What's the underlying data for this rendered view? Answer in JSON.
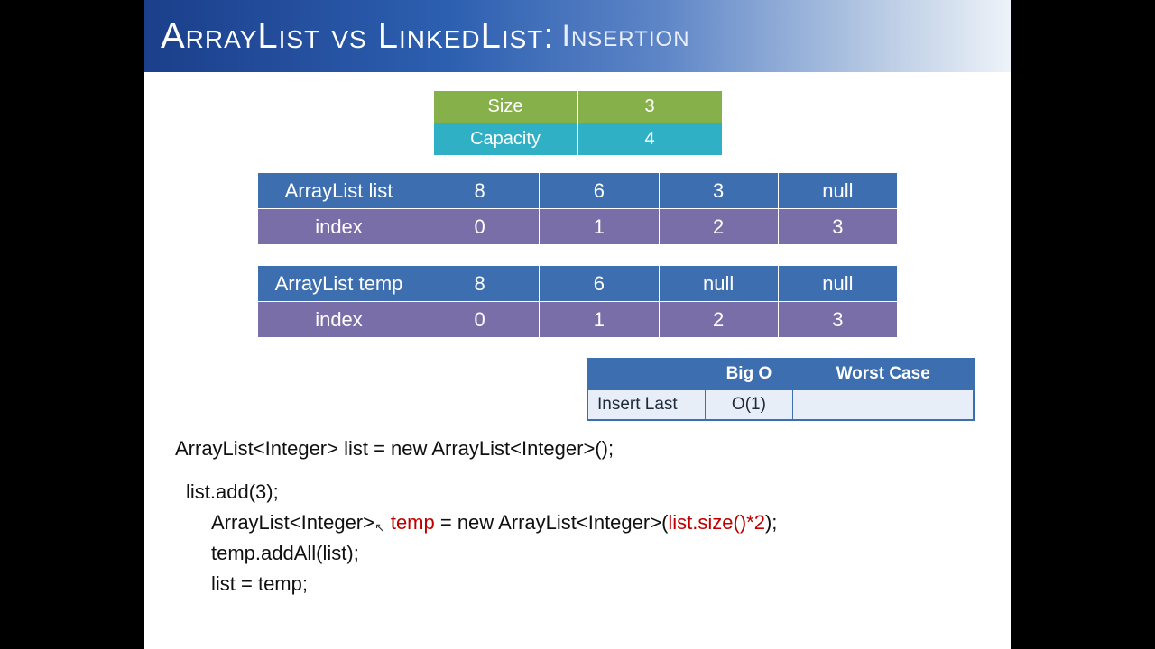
{
  "title": {
    "main": "ArrayList vs LinkedList:",
    "sub": "Insertion"
  },
  "meta": {
    "size_label": "Size",
    "size_value": "3",
    "capacity_label": "Capacity",
    "capacity_value": "4"
  },
  "list_table": {
    "label": "ArrayList  list",
    "values": [
      "8",
      "6",
      "3",
      "null"
    ],
    "index_label": "index",
    "indices": [
      "0",
      "1",
      "2",
      "3"
    ]
  },
  "temp_table": {
    "label": "ArrayList  temp",
    "values": [
      "8",
      "6",
      "null",
      "null"
    ],
    "index_label": "index",
    "indices": [
      "0",
      "1",
      "2",
      "3"
    ]
  },
  "bigo": {
    "header_blank": "",
    "header_bigo": "Big O",
    "header_worst": "Worst Case",
    "row_label": "Insert Last",
    "row_bigo": "O(1)",
    "row_worst": ""
  },
  "code": {
    "line1_a": "ArrayList<Integer> list = new ArrayList<Integer>();",
    "line2_a": "list.add(3);",
    "line3_pre": "ArrayList<Integer>",
    "line3_temp": " temp",
    "line3_mid": " = new ArrayList<Integer>(",
    "line3_arg": "list.size()*2",
    "line3_post": ");",
    "line4": "temp.addAll(list);",
    "line5": "list = temp;"
  }
}
